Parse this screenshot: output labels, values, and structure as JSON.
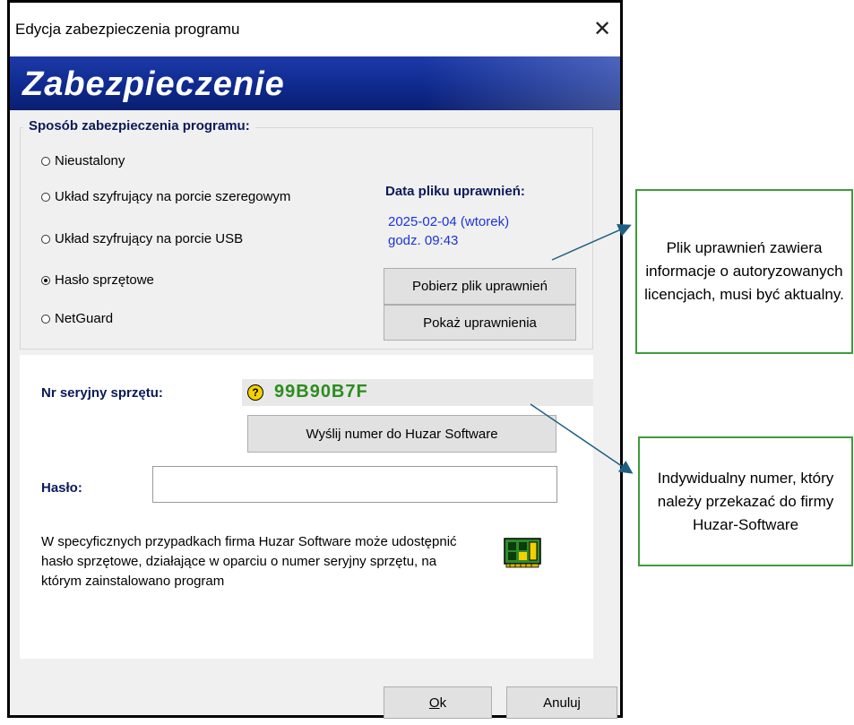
{
  "window": {
    "title": "Edycja zabezpieczenia programu",
    "close_glyph": "✕"
  },
  "banner": {
    "title": "Zabezpieczenie"
  },
  "protection": {
    "legend": "Sposób zabezpieczenia programu:",
    "options": [
      {
        "label": "Nieustalony",
        "selected": false
      },
      {
        "label": "Układ szyfrujący na porcie szeregowym",
        "selected": false
      },
      {
        "label": "Układ szyfrujący na porcie USB",
        "selected": false
      },
      {
        "label": "Hasło sprzętowe",
        "selected": true
      },
      {
        "label": "NetGuard",
        "selected": false
      }
    ]
  },
  "permissions": {
    "date_label": "Data pliku uprawnień:",
    "date_value": "2025-02-04 (wtorek)",
    "time_value": "godz. 09:43",
    "download_button": "Pobierz plik uprawnień",
    "show_button": "Pokaż uprawnienia"
  },
  "hardware": {
    "serial_label": "Nr seryjny sprzętu:",
    "help_glyph": "?",
    "serial_value": "99B90B7F",
    "send_button": "Wyślij numer do Huzar Software",
    "password_label": "Hasło:",
    "password_value": "",
    "info_text": "W specyficznych przypadkach firma Huzar Software może udostępnić hasło sprzętowe, działające w oparciu o numer seryjny sprzętu, na którym zainstalowano program",
    "chip_icon": "hardware-chip-icon"
  },
  "footer": {
    "ok_button": "Ok",
    "cancel_button": "Anuluj"
  },
  "callouts": {
    "permissions_note": "Plik uprawnień zawiera informacje o autoryzowanych licencjach, musi być aktualny.",
    "serial_note": "Indywidualny numer, który należy przekazać do firmy Huzar-Software"
  },
  "colors": {
    "banner": "#0f2a8f",
    "label_navy": "#0a1a5a",
    "date_blue": "#1a35d6",
    "serial_green": "#2c8c1e",
    "callout_border": "#3f9b3a",
    "arrow": "#1f5f82"
  }
}
